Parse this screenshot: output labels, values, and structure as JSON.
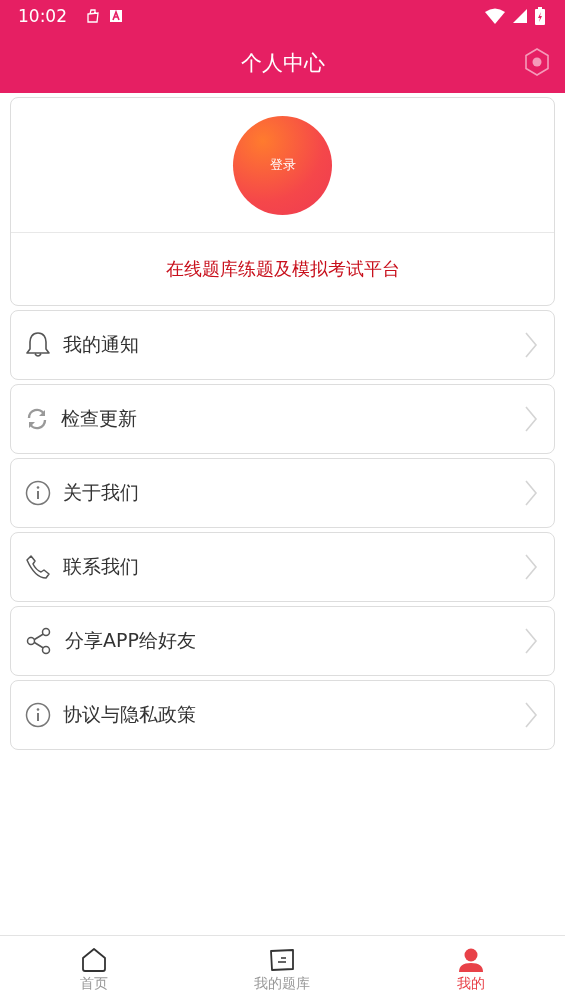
{
  "status_bar": {
    "time": "10:02"
  },
  "header": {
    "title": "个人中心"
  },
  "profile": {
    "login_button": "登录",
    "slogan": "在线题库练题及模拟考试平台"
  },
  "menu": [
    {
      "kind": "bell",
      "label": "我的通知"
    },
    {
      "kind": "refresh",
      "label": "检查更新"
    },
    {
      "kind": "info",
      "label": "关于我们"
    },
    {
      "kind": "phone",
      "label": "联系我们"
    },
    {
      "kind": "share",
      "label": "分享APP给好友"
    },
    {
      "kind": "info",
      "label": "协议与隐私政策"
    }
  ],
  "tabs": [
    {
      "kind": "home",
      "label": "首页",
      "selected": false
    },
    {
      "kind": "bank",
      "label": "我的题库",
      "selected": false
    },
    {
      "kind": "person",
      "label": "我的",
      "selected": true
    }
  ]
}
